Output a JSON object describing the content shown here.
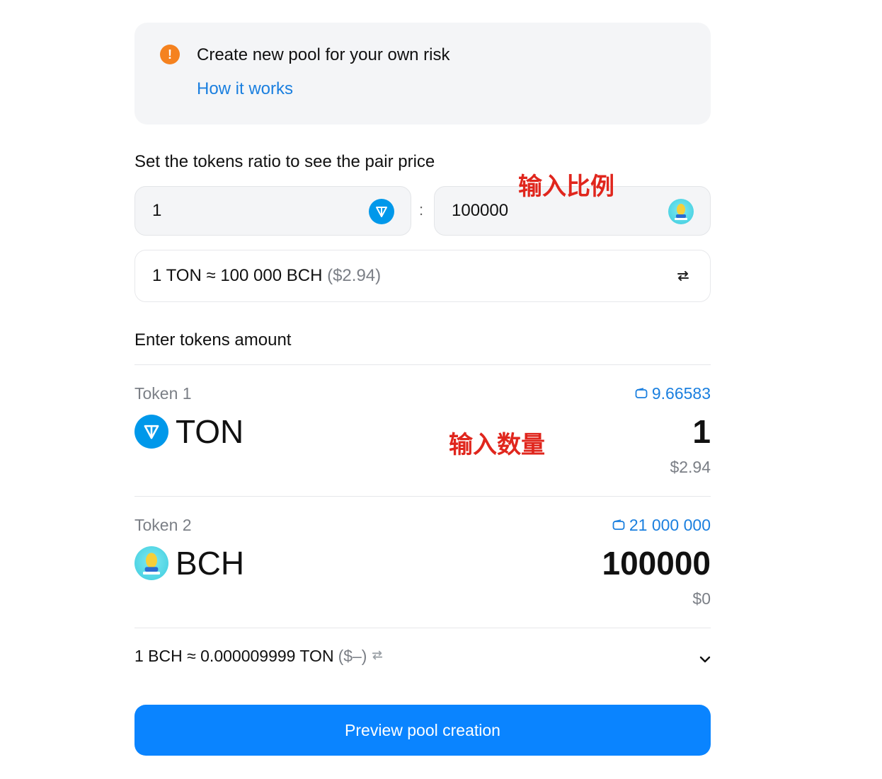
{
  "warning": {
    "message": "Create new pool for your own risk",
    "link": "How it works",
    "icon": "exclamation-icon",
    "icon_glyph": "!",
    "color": "#f5821f"
  },
  "ratio": {
    "title": "Set the tokens ratio to see the pair price",
    "value_1": "1",
    "value_2": "100000",
    "separator": ":",
    "token_1_icon": "ton-logo-icon",
    "token_2_icon": "bch-logo-icon"
  },
  "price": {
    "text": "1 TON ≈ 100 000 BCH",
    "usd": "($2.94)",
    "swap_icon": "swap-arrows-icon"
  },
  "amounts": {
    "title": "Enter tokens amount",
    "token_1": {
      "label": "Token 1",
      "symbol": "TON",
      "balance": "9.66583",
      "amount": "1",
      "usd": "$2.94"
    },
    "token_2": {
      "label": "Token 2",
      "symbol": "BCH",
      "balance": "21 000 000",
      "amount": "100000",
      "usd": "$0"
    }
  },
  "rate": {
    "text": "1 BCH ≈ 0.000009999 TON",
    "usd": "($–)"
  },
  "cta": {
    "label": "Preview pool creation",
    "color": "#0a84ff"
  },
  "annotations": {
    "ratio_note": "输入比例",
    "amount_note": "输入数量",
    "color": "#e0261d"
  },
  "colors": {
    "link": "#1a7fdf",
    "ton": "#0098ea"
  }
}
